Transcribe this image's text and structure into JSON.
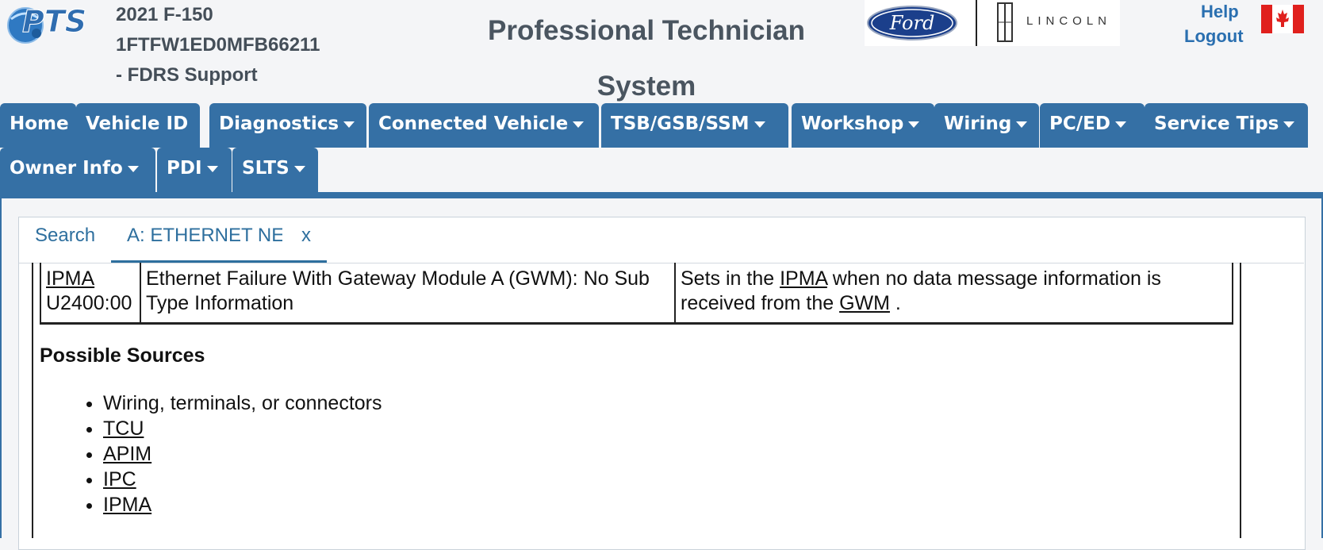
{
  "header": {
    "vehicle_model": "2021 F-150",
    "vin": "1FTFW1ED0MFB66211",
    "support": "- FDRS Support",
    "app_title": "Professional Technician System",
    "lincoln_text": "LINCOLN",
    "help": "Help",
    "logout": "Logout"
  },
  "nav": {
    "row1": [
      {
        "label": "Home",
        "dropdown": false
      },
      {
        "label": "Vehicle ID",
        "dropdown": false
      },
      {
        "label": "Diagnostics",
        "dropdown": true
      },
      {
        "label": "Connected Vehicle",
        "dropdown": true
      },
      {
        "label": "TSB/GSB/SSM",
        "dropdown": true
      },
      {
        "label": "Workshop",
        "dropdown": true
      },
      {
        "label": "Wiring",
        "dropdown": true
      },
      {
        "label": "PC/ED",
        "dropdown": true
      },
      {
        "label": "Service Tips",
        "dropdown": true
      }
    ],
    "row2": [
      {
        "label": "Owner Info",
        "dropdown": true
      },
      {
        "label": "PDI",
        "dropdown": true
      },
      {
        "label": "SLTS",
        "dropdown": true
      }
    ]
  },
  "tabs": {
    "search": "Search",
    "active": "A: ETHERNET NE",
    "close": "x"
  },
  "dtc_row": {
    "module": "IPMA",
    "code": "U2400:00",
    "description": "Ethernet Failure With Gateway Module A (GWM): No Sub Type Information",
    "condition_prefix": "Sets in the",
    "condition_module": "IPMA",
    "condition_mid": "when no data message information is received from the",
    "condition_gwm": "GWM",
    "condition_end": "."
  },
  "possible_sources": {
    "heading": "Possible Sources",
    "items": [
      {
        "text": "Wiring, terminals, or connectors",
        "link": false
      },
      {
        "text": "TCU",
        "link": true
      },
      {
        "text": "APIM",
        "link": true
      },
      {
        "text": "IPC",
        "link": true
      },
      {
        "text": "IPMA",
        "link": true
      }
    ]
  },
  "colors": {
    "nav_blue": "#3570a5",
    "link_blue": "#2a6fb0",
    "header_text": "#444e58"
  },
  "icons": [
    "pts-logo",
    "ford-logo",
    "lincoln-star-icon",
    "canada-flag-icon",
    "caret-down-icon"
  ]
}
